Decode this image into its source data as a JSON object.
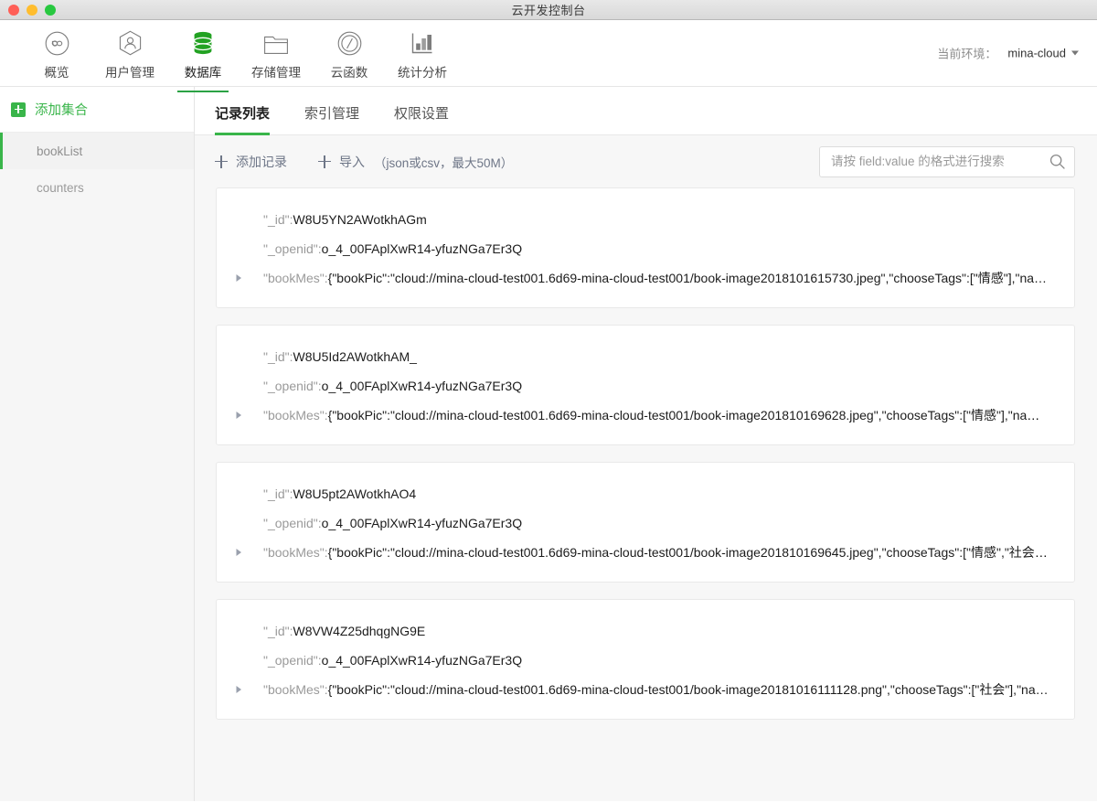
{
  "window": {
    "title": "云开发控制台",
    "traffic_lights": [
      "close-button",
      "minimize-button",
      "maximize-button"
    ]
  },
  "topnav": {
    "items": [
      {
        "label": "概览",
        "icon": "infinity-circle-icon",
        "active": false
      },
      {
        "label": "用户管理",
        "icon": "user-hexagon-icon",
        "active": false
      },
      {
        "label": "数据库",
        "icon": "database-icon",
        "active": true
      },
      {
        "label": "存储管理",
        "icon": "folder-icon",
        "active": false
      },
      {
        "label": "云函数",
        "icon": "slash-circle-icon",
        "active": false
      },
      {
        "label": "统计分析",
        "icon": "bar-chart-icon",
        "active": false
      }
    ],
    "env_label": "当前环境：",
    "env_value": "mina-cloud",
    "env_caret": "chevron-down-icon",
    "active_color": "#2ba245"
  },
  "sidebar": {
    "add_collection_label": "添加集合",
    "add_collection_icon": "plus-square-icon",
    "collections": [
      {
        "name": "bookList",
        "active": true
      },
      {
        "name": "counters",
        "active": false
      }
    ],
    "accent_color": "#39b54a"
  },
  "main": {
    "tabs": [
      {
        "label": "记录列表",
        "active": true
      },
      {
        "label": "索引管理",
        "active": false
      },
      {
        "label": "权限设置",
        "active": false
      }
    ],
    "toolbar": {
      "add_record_label": "添加记录",
      "import_label": "导入",
      "import_hint": "（json或csv，最大50M）"
    },
    "search": {
      "placeholder": "请按 field:value 的格式进行搜索",
      "value": "",
      "icon": "search-icon"
    },
    "records": [
      {
        "id_key": "\"_id\":",
        "id_value": "W8U5YN2AWotkhAGm",
        "openid_key": "\"_openid\":",
        "openid_value": "o_4_00FAplXwR14-yfuzNGa7Er3Q",
        "bookmes_key": "\"bookMes\":",
        "bookmes_value": "{\"bookPic\":\"cloud://mina-cloud-test001.6d69-mina-cloud-test001/book-image2018101615730.jpeg\",\"chooseTags\":[\"情感\"],\"na…",
        "toggle_icon": "triangle-right-icon"
      },
      {
        "id_key": "\"_id\":",
        "id_value": "W8U5Id2AWotkhAM_",
        "openid_key": "\"_openid\":",
        "openid_value": "o_4_00FAplXwR14-yfuzNGa7Er3Q",
        "bookmes_key": "\"bookMes\":",
        "bookmes_value": "{\"bookPic\":\"cloud://mina-cloud-test001.6d69-mina-cloud-test001/book-image201810169628.jpeg\",\"chooseTags\":[\"情感\"],\"nam…",
        "toggle_icon": "triangle-right-icon"
      },
      {
        "id_key": "\"_id\":",
        "id_value": "W8U5pt2AWotkhAO4",
        "openid_key": "\"_openid\":",
        "openid_value": "o_4_00FAplXwR14-yfuzNGa7Er3Q",
        "bookmes_key": "\"bookMes\":",
        "bookmes_value": "{\"bookPic\":\"cloud://mina-cloud-test001.6d69-mina-cloud-test001/book-image201810169645.jpeg\",\"chooseTags\":[\"情感\",\"社会\"…",
        "toggle_icon": "triangle-right-icon"
      },
      {
        "id_key": "\"_id\":",
        "id_value": "W8VW4Z25dhqgNG9E",
        "openid_key": "\"_openid\":",
        "openid_value": "o_4_00FAplXwR14-yfuzNGa7Er3Q",
        "bookmes_key": "\"bookMes\":",
        "bookmes_value": "{\"bookPic\":\"cloud://mina-cloud-test001.6d69-mina-cloud-test001/book-image20181016111128.png\",\"chooseTags\":[\"社会\"],\"na…",
        "toggle_icon": "triangle-right-icon"
      }
    ]
  }
}
